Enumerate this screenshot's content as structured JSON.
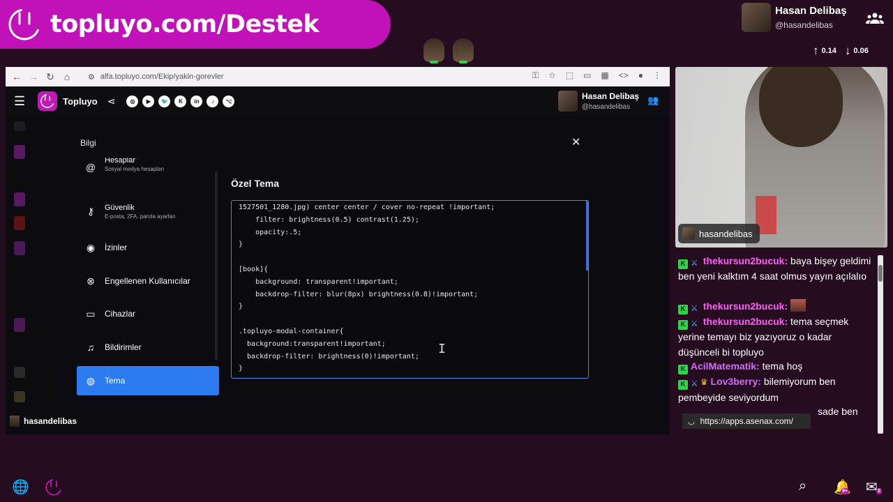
{
  "banner": {
    "text": "topluyo.com/Destek"
  },
  "streamer": {
    "name": "Hasan Delibaş",
    "handle": "@hasandelibas"
  },
  "rates": {
    "up": "0.14",
    "down": "0.06"
  },
  "browser": {
    "url": "alfa.topluyo.com/Ekip/yakin-gorevler",
    "app": {
      "brand": "Topluyo",
      "user_name": "Hasan Delibaş",
      "user_handle": "@hasandelibas",
      "socials": [
        "◎",
        "▶",
        "🐦",
        "K",
        "in",
        "♪",
        "⌥"
      ]
    },
    "modal": {
      "title": "Bilgi",
      "close": "✕",
      "sidebar": [
        {
          "label": "Hesaplar",
          "sub": "Sosyal medya hesapları",
          "icon": "at-icon"
        },
        {
          "label": "Güvenlik",
          "sub": "E-posta, 2FA, parola ayarları",
          "icon": "user-lock-icon"
        },
        {
          "label": "İzinler",
          "sub": "",
          "icon": "eye-icon"
        },
        {
          "label": "Engellenen Kullanıcılar",
          "sub": "",
          "icon": "blocked-icon"
        },
        {
          "label": "Cihazlar",
          "sub": "",
          "icon": "devices-icon"
        },
        {
          "label": "Bildirimler",
          "sub": "",
          "icon": "bell-icon"
        },
        {
          "label": "Tema",
          "sub": "",
          "icon": "palette-icon"
        }
      ],
      "section_title": "Özel Tema",
      "code": "1527501_1280.jpg) center center / cover no-repeat !important;\n    filter: brightness(0.5) contrast(1.25);\n    opacity:.5;\n}\n\n[book]{\n    background: transparent!important;\n    backdrop-filter: blur(8px) brightness(0.8)!important;\n}\n\n.topluyo-modal-container{\n  background:transparent!important;\n  backdrop-filter: brightness(0)!important;\n}"
    },
    "bottom_user": "hasandelibas"
  },
  "cam": {
    "tag": "hasandelibas"
  },
  "chat": [
    {
      "user": "thekursun2bucuk",
      "text": "baya bişey geldimi ben yeni kalktım 4 saat olmus yayın açılalıo"
    },
    {
      "user": "thekursun2bucuk",
      "text": ""
    },
    {
      "user": "thekursun2bucuk",
      "text": "tema seçmek yerine temayı biz yazıyoruz o kadar düşünceli bi topluyo"
    },
    {
      "user": "AcilMatematik",
      "text": "tema hoş"
    },
    {
      "user": "Lov3berry",
      "text": "bilemiyorum ben pembeyide seviyordum"
    },
    {
      "user": "",
      "text": "sade ben"
    }
  ],
  "chat_popup": "https://apps.asenax.com/",
  "taskbar": {
    "bell_badge": "9+",
    "mail_badge": "2"
  }
}
